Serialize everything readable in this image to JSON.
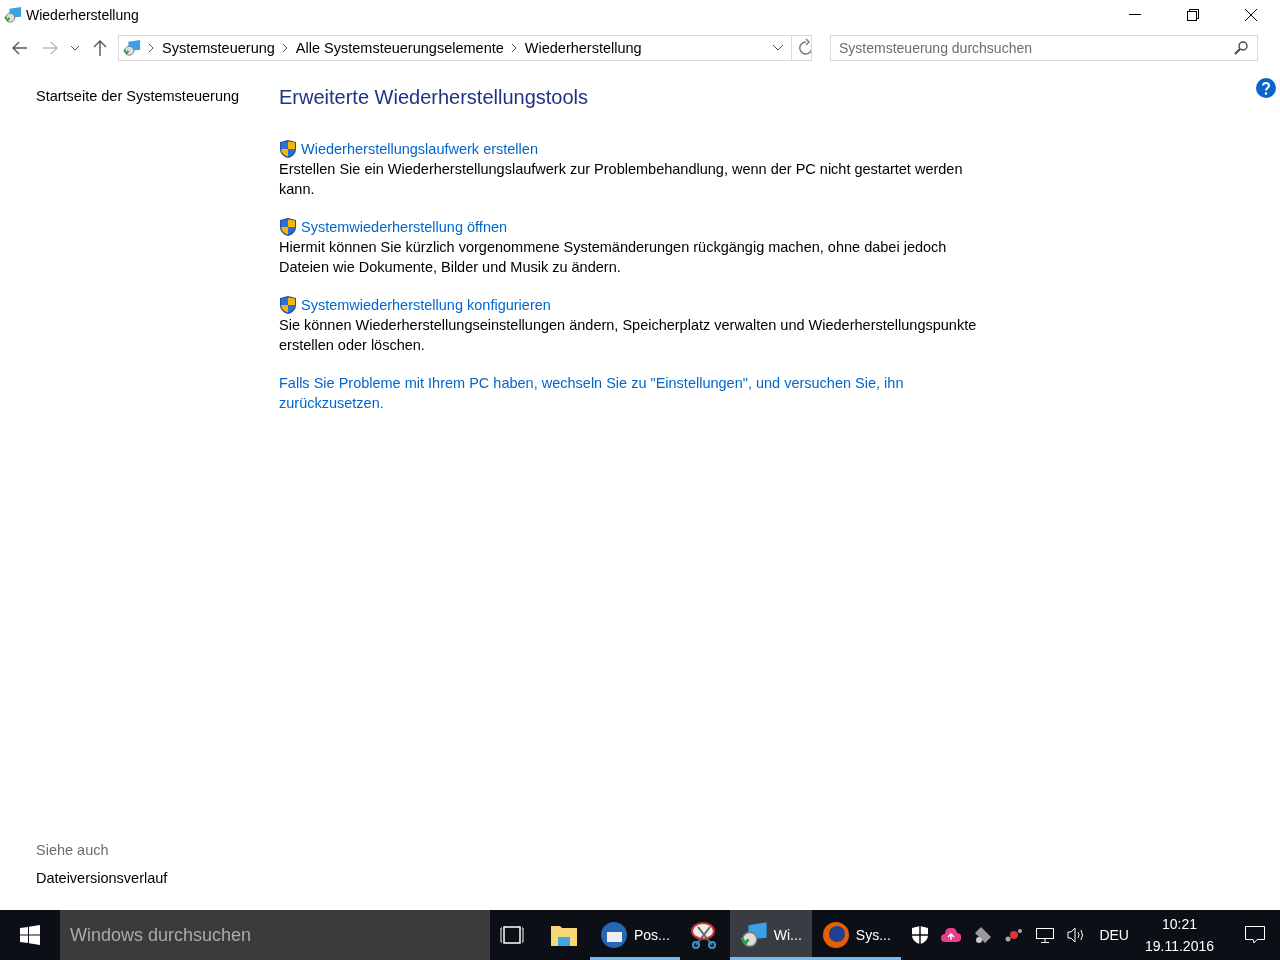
{
  "window": {
    "title": "Wiederherstellung"
  },
  "address_bar": {
    "crumbs": [
      "Systemsteuerung",
      "Alle Systemsteuerungselemente",
      "Wiederherstellung"
    ]
  },
  "search": {
    "placeholder": "Systemsteuerung durchsuchen"
  },
  "sidebar": {
    "home_link": "Startseite der Systemsteuerung",
    "see_also_heading": "Siehe auch",
    "see_also_links": [
      "Dateiversionsverlauf"
    ]
  },
  "main": {
    "heading": "Erweiterte Wiederherstellungstools",
    "tools": [
      {
        "link": "Wiederherstellungslaufwerk erstellen",
        "description": "Erstellen Sie ein Wiederherstellungslaufwerk zur Problembehandlung, wenn der PC nicht gestartet werden kann."
      },
      {
        "link": "Systemwiederherstellung öffnen",
        "description": "Hiermit können Sie kürzlich vorgenommene Systemänderungen rückgängig machen, ohne dabei jedoch Dateien wie Dokumente, Bilder und Musik zu ändern."
      },
      {
        "link": "Systemwiederherstellung konfigurieren",
        "description": "Sie können Wiederherstellungseinstellungen ändern, Speicherplatz verwalten und Wiederherstellungspunkte erstellen oder löschen."
      }
    ],
    "reset_link": "Falls Sie Probleme mit Ihrem PC haben, wechseln Sie zu \"Einstellungen\", und versuchen Sie, ihn zurückzusetzen."
  },
  "taskbar": {
    "search_placeholder": "Windows durchsuchen",
    "apps": [
      {
        "kind": "taskview",
        "running": false,
        "selected": false
      },
      {
        "kind": "folder",
        "running": false,
        "selected": false
      },
      {
        "kind": "mail",
        "label": "Pos...",
        "running": true,
        "selected": false
      },
      {
        "kind": "scissors",
        "running": false,
        "selected": false
      },
      {
        "kind": "recovery",
        "label": "Wi...",
        "running": true,
        "selected": true
      },
      {
        "kind": "browser",
        "label": "Sys...",
        "running": true,
        "selected": false
      }
    ],
    "language": "DEU",
    "time": "10:21",
    "date": "19.11.2016"
  }
}
